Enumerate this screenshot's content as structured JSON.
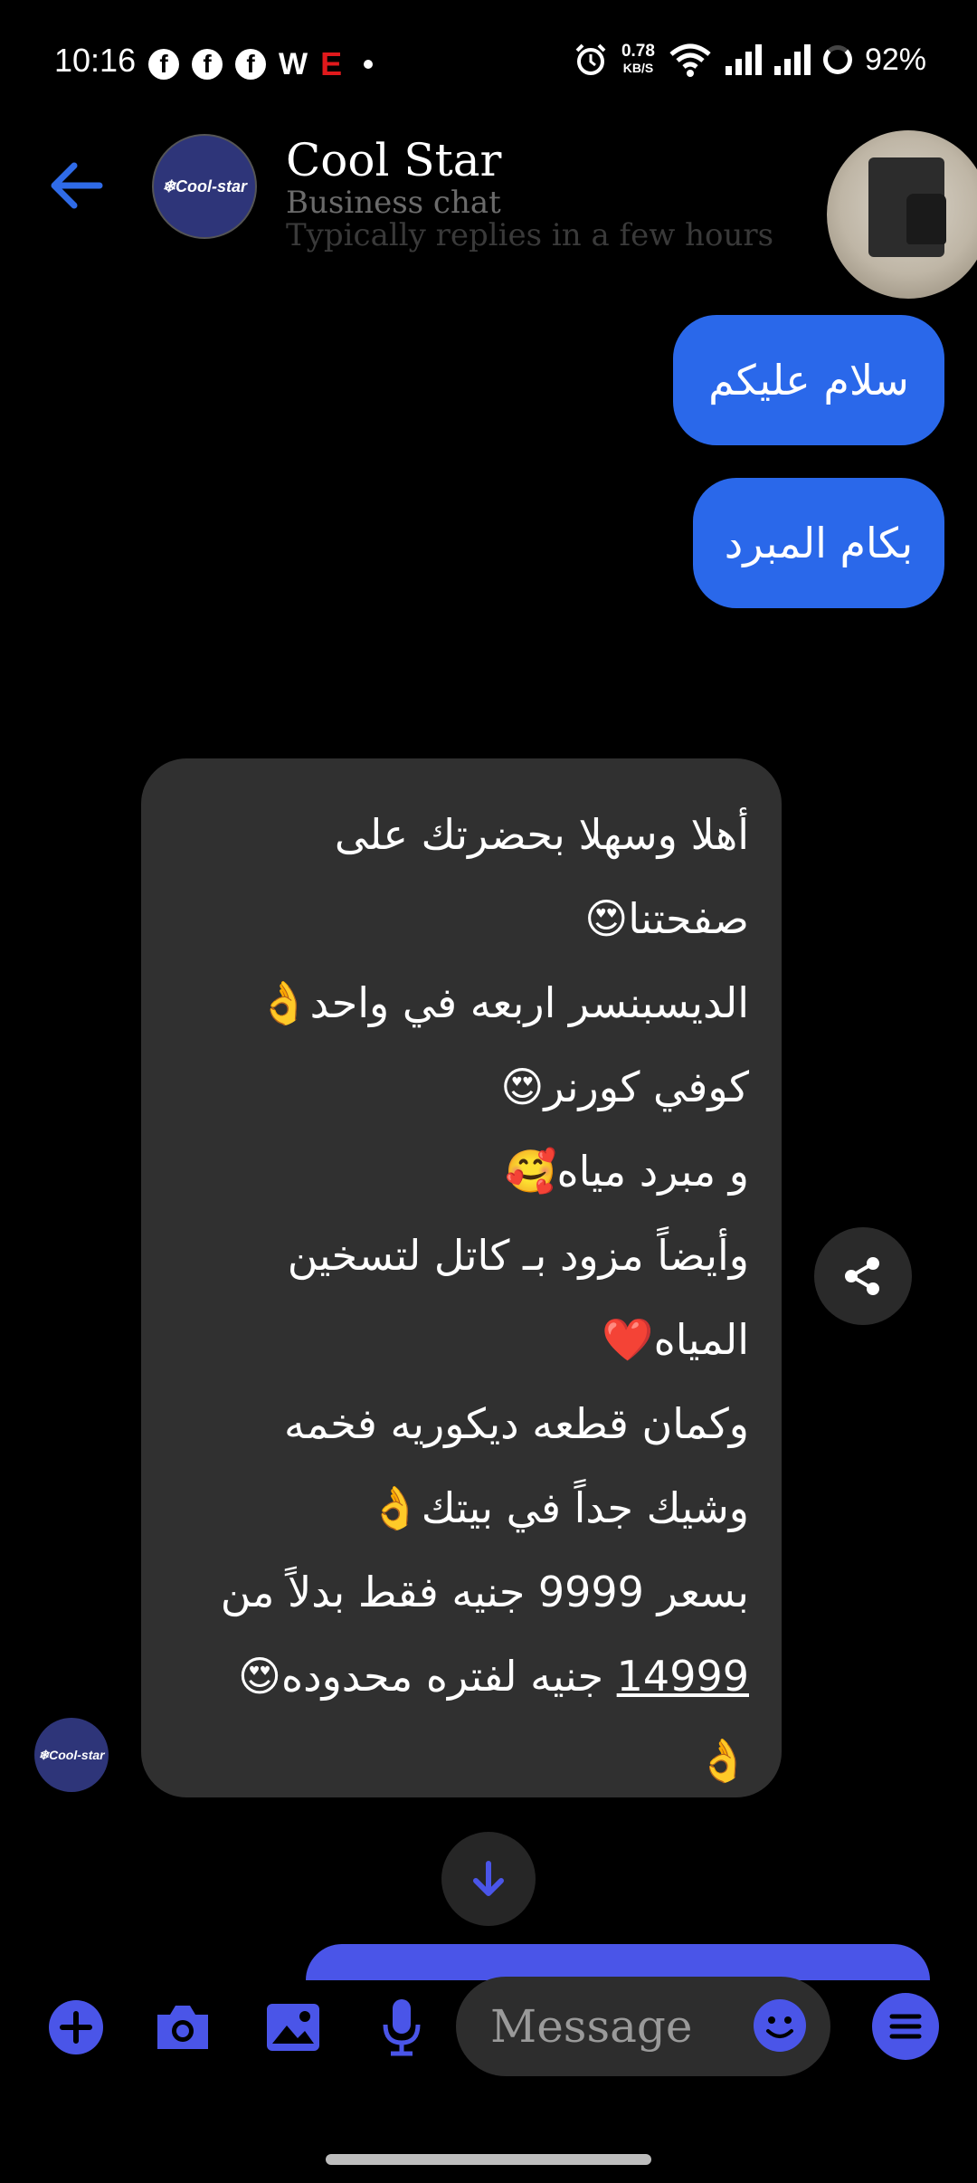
{
  "status_bar": {
    "time": "10:16",
    "speed_value": "0.78",
    "speed_unit": "KB/S",
    "battery": "92%",
    "notification_icons": [
      "facebook-icon",
      "facebook-icon",
      "facebook-icon",
      "w-icon",
      "e-icon",
      "dot-icon"
    ]
  },
  "header": {
    "name": "Cool Star",
    "subtitle": "Business chat",
    "reply_time": "Typically replies in a few hours",
    "avatar_text": "❄Cool-star"
  },
  "messages": {
    "sent": [
      "سلام عليكم",
      "بكام المبرد"
    ],
    "received_lines": [
      "أهلا وسهلا بحضرتك على",
      "صفحتنا😍",
      "الديسبنسر اربعه في واحد👌",
      "كوفي كورنر😍",
      "و مبرد مياه🥰",
      "وأيضاً مزود بـ كاتل لتسخين",
      "المياه❤️",
      "وكمان قطعه ديكوريه فخمه",
      "وشيك جداً في بيتك👌",
      "بسعر 9999 جنيه فقط بدلاً من",
      "جنيه لفتره محدوده😍",
      "👌"
    ],
    "old_price": "14999",
    "recv_avatar_text": "❄Cool-star"
  },
  "composer": {
    "placeholder": "Message"
  },
  "colors": {
    "accent": "#4a55e8",
    "sent_bubble": "#2a68ea",
    "received_bubble": "#303030",
    "back_arrow": "#2f6be8"
  }
}
